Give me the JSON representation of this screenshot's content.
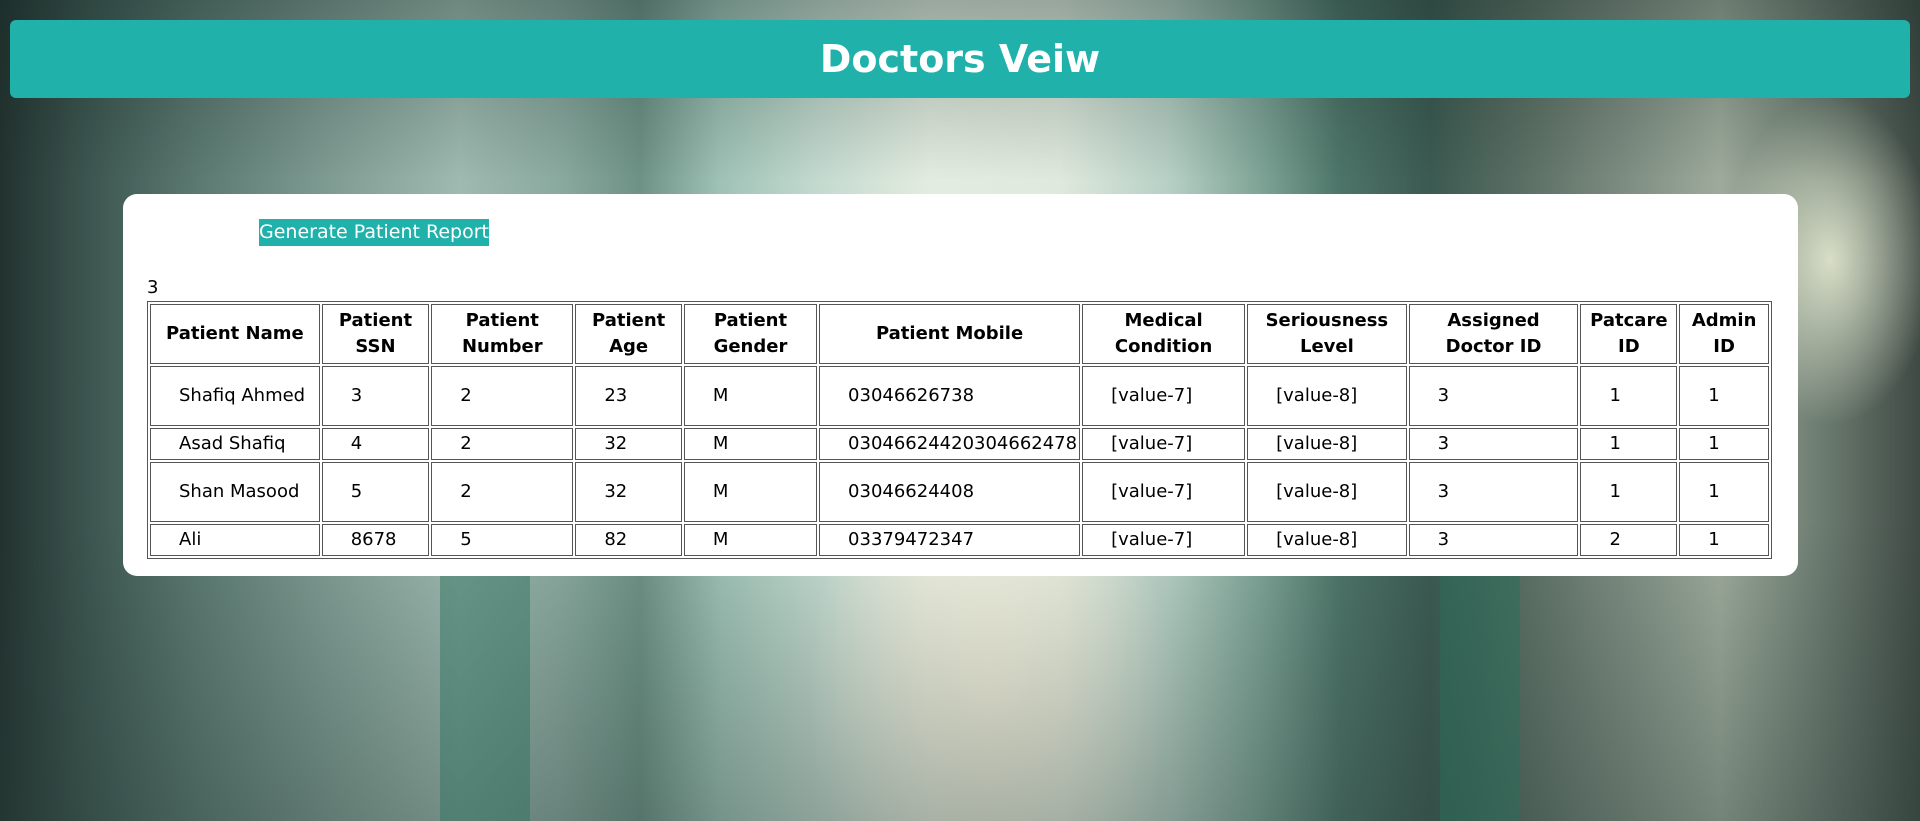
{
  "header": {
    "title": "Doctors Veiw"
  },
  "panel": {
    "report_button": "Generate Patient Report",
    "record_count": "3"
  },
  "table": {
    "columns": [
      "Patient Name",
      "Patient SSN",
      "Patient Number",
      "Patient Age",
      "Patient Gender",
      "Patient Mobile",
      "Medical Condition",
      "Seriousness Level",
      "Assigned Doctor ID",
      "Patcare ID",
      "Admin ID"
    ],
    "rows": [
      [
        "Shafiq Ahmed",
        "3",
        "2",
        "23",
        "M",
        "03046626738",
        "[value-7]",
        "[value-8]",
        "3",
        "1",
        "1"
      ],
      [
        "Asad Shafiq",
        "4",
        "2",
        "32",
        "M",
        "03046624420304662478",
        "[value-7]",
        "[value-8]",
        "3",
        "1",
        "1"
      ],
      [
        "Shan Masood",
        "5",
        "2",
        "32",
        "M",
        "03046624408",
        "[value-7]",
        "[value-8]",
        "3",
        "1",
        "1"
      ],
      [
        "Ali",
        "8678",
        "5",
        "82",
        "M",
        "03379472347",
        "[value-7]",
        "[value-8]",
        "3",
        "2",
        "1"
      ]
    ]
  }
}
